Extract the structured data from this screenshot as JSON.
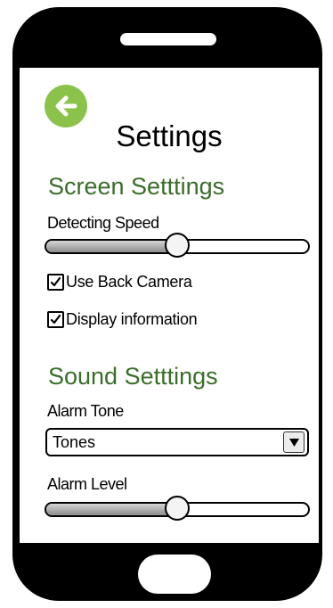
{
  "page": {
    "title": "Settings"
  },
  "navigation": {
    "back_icon": "arrow-left-icon"
  },
  "screen_settings": {
    "heading": "Screen Setttings",
    "detecting_speed": {
      "label": "Detecting Speed",
      "value_fraction": 0.5
    },
    "use_back_camera": {
      "label": "Use Back Camera",
      "checked": true
    },
    "display_information": {
      "label": "Display information",
      "checked": true
    }
  },
  "sound_settings": {
    "heading": "Sound Setttings",
    "alarm_tone": {
      "label": "Alarm Tone",
      "selected": "Tones"
    },
    "alarm_level": {
      "label": "Alarm Level",
      "value_fraction": 0.5
    }
  },
  "colors": {
    "accent_green": "#8bc24a",
    "heading_green": "#3a6e2a",
    "phone_body": "#000000"
  }
}
